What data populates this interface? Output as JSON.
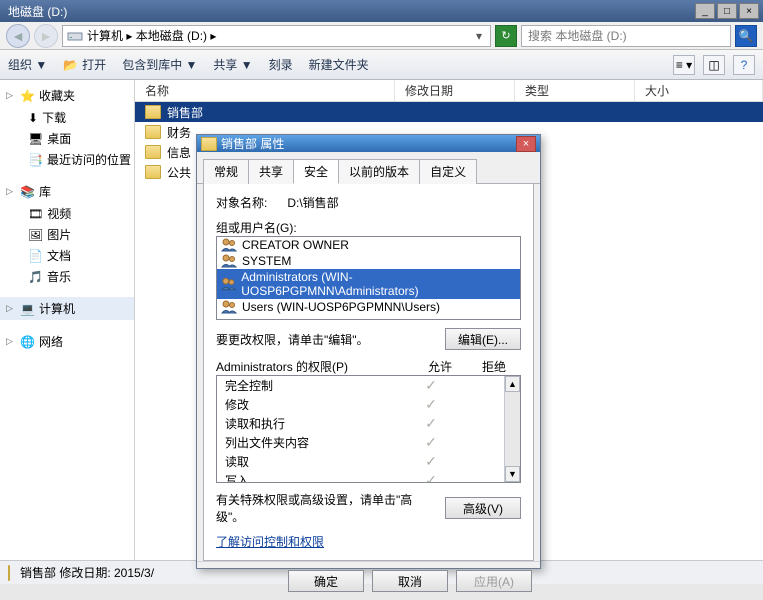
{
  "window": {
    "title": "地磁盘 (D:)"
  },
  "addressbar": {
    "breadcrumb": "计算机 ▸ 本地磁盘 (D:) ▸",
    "search_placeholder": "搜索 本地磁盘 (D:)"
  },
  "cmdbar": {
    "organize": "组织 ▼",
    "open": "打开",
    "include": "包含到库中 ▼",
    "share": "共享 ▼",
    "burn": "刻录",
    "newfolder": "新建文件夹"
  },
  "sidebar": {
    "fav": "收藏夹",
    "download": "下载",
    "desktop": "桌面",
    "recent": "最近访问的位置",
    "lib": "库",
    "video": "视频",
    "pic": "图片",
    "doc": "文档",
    "music": "音乐",
    "computer": "计算机",
    "network": "网络"
  },
  "columns": {
    "name": "名称",
    "modified": "修改日期",
    "type": "类型",
    "size": "大小"
  },
  "folders": [
    {
      "name": "销售部",
      "selected": true
    },
    {
      "name": "财务",
      "selected": false
    },
    {
      "name": "信息",
      "selected": false
    },
    {
      "name": "公共",
      "selected": false
    }
  ],
  "statusbar": {
    "text": "销售部 修改日期: 2015/3/"
  },
  "dialog": {
    "title": "销售部 属性",
    "tabs": {
      "general": "常规",
      "share": "共享",
      "security": "安全",
      "prev": "以前的版本",
      "custom": "自定义"
    },
    "object_label": "对象名称:",
    "object_value": "D:\\销售部",
    "groups_label": "组或用户名(G):",
    "principals": [
      {
        "name": "CREATOR OWNER",
        "selected": false
      },
      {
        "name": "SYSTEM",
        "selected": false
      },
      {
        "name": "Administrators (WIN-UOSP6PGPMNN\\Administrators)",
        "selected": true
      },
      {
        "name": "Users (WIN-UOSP6PGPMNN\\Users)",
        "selected": false
      }
    ],
    "edit_hint": "要更改权限，请单击\"编辑\"。",
    "edit_btn": "编辑(E)...",
    "perm_header": "Administrators 的权限(P)",
    "allow": "允许",
    "deny": "拒绝",
    "perms": [
      {
        "name": "完全控制",
        "allow": true
      },
      {
        "name": "修改",
        "allow": true
      },
      {
        "name": "读取和执行",
        "allow": true
      },
      {
        "name": "列出文件夹内容",
        "allow": true
      },
      {
        "name": "读取",
        "allow": true
      },
      {
        "name": "写入",
        "allow": true
      }
    ],
    "advanced_hint": "有关特殊权限或高级设置，请单击\"高级\"。",
    "advanced_btn": "高级(V)",
    "learn_link": "了解访问控制和权限",
    "ok": "确定",
    "cancel": "取消",
    "apply": "应用(A)"
  }
}
